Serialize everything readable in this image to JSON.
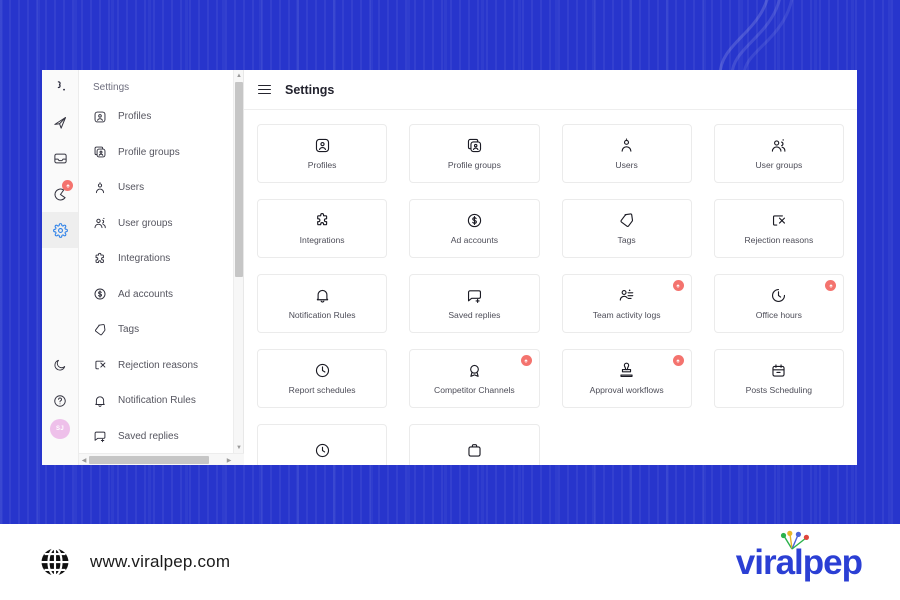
{
  "theme": {
    "background_blue": "#2735cc",
    "accent_blue": "#2b3fd4",
    "badge_red": "#f4736e",
    "active_icon_blue": "#2a7fe8",
    "avatar_pink": "#eec0ea"
  },
  "rail": {
    "logo": "rail-logo-icon",
    "items": [
      {
        "name": "publish-icon",
        "badge": false
      },
      {
        "name": "inbox-icon",
        "badge": false
      },
      {
        "name": "analytics-icon",
        "badge": true
      },
      {
        "name": "settings-icon",
        "badge": false,
        "active": true
      }
    ],
    "bottom_items": [
      {
        "name": "moon-icon"
      },
      {
        "name": "help-icon"
      }
    ],
    "avatar_initials": "SJ"
  },
  "nav": {
    "title": "Settings",
    "items": [
      {
        "label": "Profiles",
        "icon": "profile-badge-icon"
      },
      {
        "label": "Profile groups",
        "icon": "profile-groups-icon"
      },
      {
        "label": "Users",
        "icon": "user-icon"
      },
      {
        "label": "User groups",
        "icon": "users-group-icon"
      },
      {
        "label": "Integrations",
        "icon": "puzzle-icon"
      },
      {
        "label": "Ad accounts",
        "icon": "dollar-circle-icon"
      },
      {
        "label": "Tags",
        "icon": "tag-icon"
      },
      {
        "label": "Rejection reasons",
        "icon": "reject-icon"
      },
      {
        "label": "Notification Rules",
        "icon": "bell-icon"
      },
      {
        "label": "Saved replies",
        "icon": "saved-reply-icon"
      }
    ]
  },
  "header": {
    "menu_icon": "hamburger-icon",
    "title": "Settings"
  },
  "cards": [
    {
      "label": "Profiles",
      "icon": "profile-badge-icon",
      "badge": false
    },
    {
      "label": "Profile groups",
      "icon": "profile-groups-icon",
      "badge": false
    },
    {
      "label": "Users",
      "icon": "user-icon",
      "badge": false
    },
    {
      "label": "User groups",
      "icon": "users-group-icon",
      "badge": false
    },
    {
      "label": "Integrations",
      "icon": "puzzle-icon",
      "badge": false
    },
    {
      "label": "Ad accounts",
      "icon": "dollar-circle-icon",
      "badge": false
    },
    {
      "label": "Tags",
      "icon": "tag-icon",
      "badge": false
    },
    {
      "label": "Rejection reasons",
      "icon": "reject-icon",
      "badge": false
    },
    {
      "label": "Notification Rules",
      "icon": "bell-icon",
      "badge": false
    },
    {
      "label": "Saved replies",
      "icon": "saved-reply-icon",
      "badge": false
    },
    {
      "label": "Team activity logs",
      "icon": "activity-log-icon",
      "badge": true
    },
    {
      "label": "Office hours",
      "icon": "office-hours-icon",
      "badge": true
    },
    {
      "label": "Report schedules",
      "icon": "clock-icon",
      "badge": false
    },
    {
      "label": "Competitor Channels",
      "icon": "competitor-icon",
      "badge": true
    },
    {
      "label": "Approval workflows",
      "icon": "stamp-icon",
      "badge": true
    },
    {
      "label": "Posts Scheduling",
      "icon": "calendar-icon",
      "badge": false
    },
    {
      "label": "",
      "icon": "partial-icon-a",
      "badge": false
    },
    {
      "label": "",
      "icon": "partial-icon-b",
      "badge": false
    }
  ],
  "footer": {
    "globe_icon": "globe-icon",
    "url": "www.viralpep.com",
    "brand_name": "viralpep",
    "brand_spark_icon": "spark-dots-icon"
  }
}
